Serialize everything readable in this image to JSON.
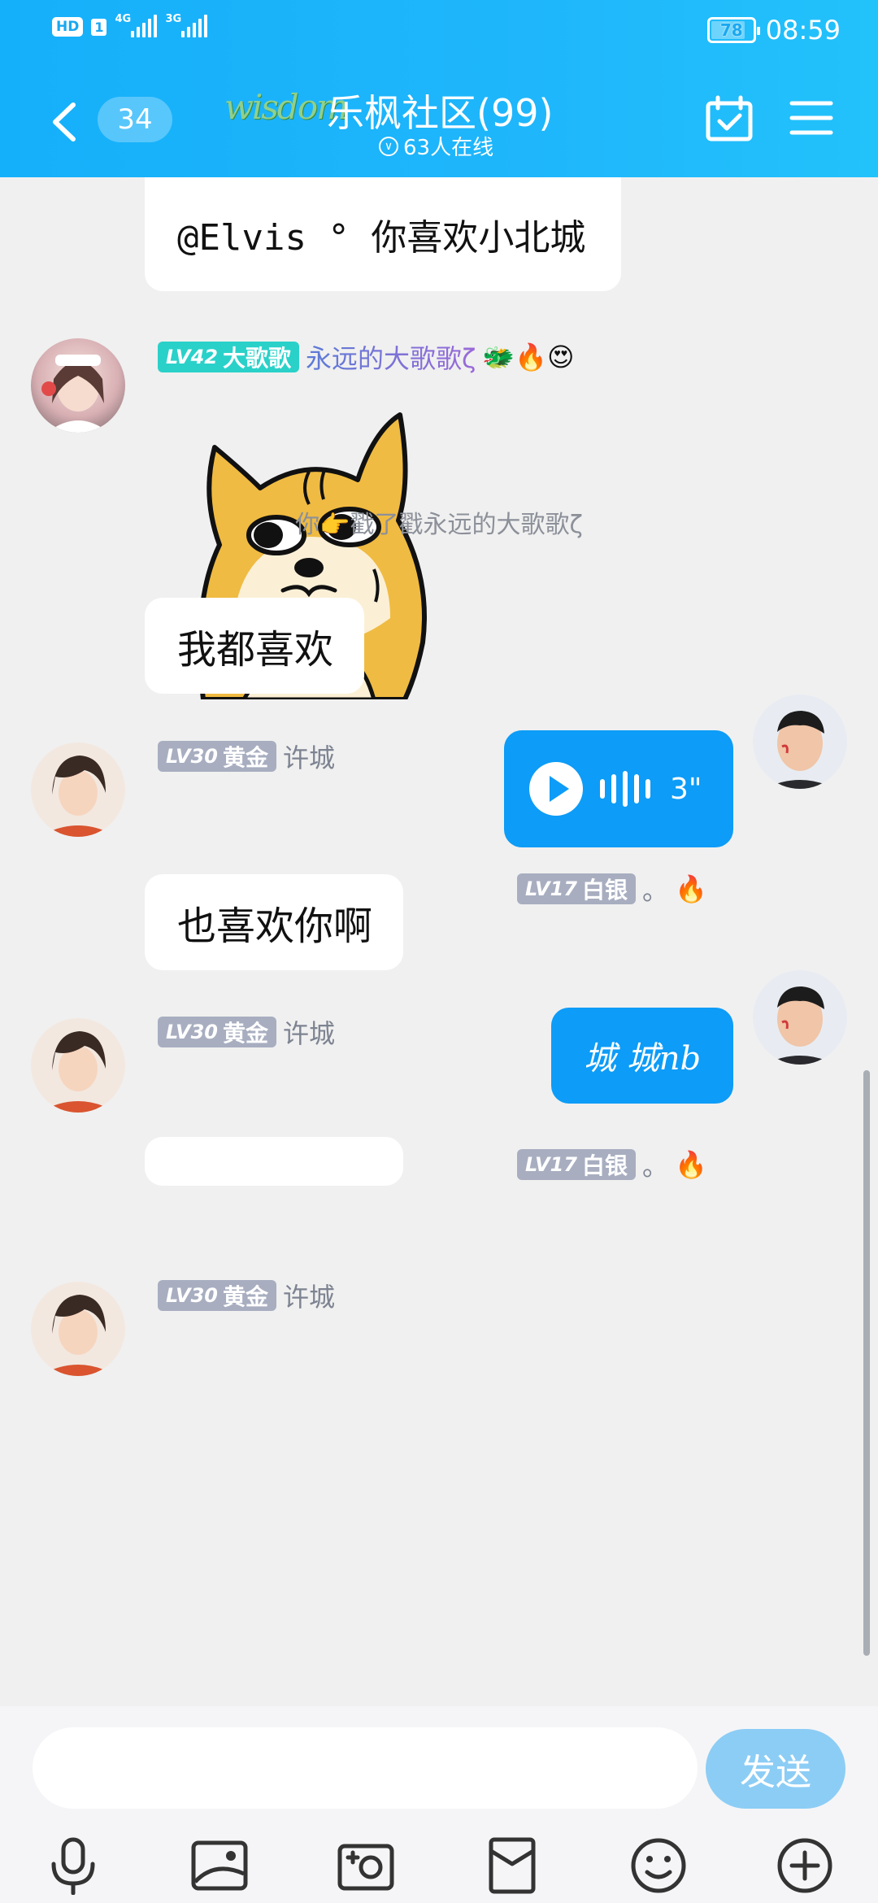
{
  "status_bar": {
    "hd_label": "HD",
    "sim_label": "1",
    "net1": "4G",
    "net2": "3G",
    "battery": "78",
    "time": "08:59"
  },
  "nav": {
    "unread_count": "34",
    "logo_text": "wisdom",
    "group_title": "乐枫社区(99)",
    "online_text": "63人在线"
  },
  "messages": [
    {
      "type": "partial",
      "text": "@Elvis ° 你喜欢小北城"
    },
    {
      "type": "sticker",
      "level_num": "LV42",
      "title": "大歌歌",
      "nickname": "永远的大歌歌ζ",
      "emoji": "🐲🔥😍"
    },
    {
      "type": "system",
      "text": "你👉戳了戳永远的大歌歌ζ"
    },
    {
      "type": "text",
      "level_num": "LV30",
      "title": "黄金",
      "nickname": "许城",
      "text": "我都喜欢"
    },
    {
      "type": "voice",
      "level_num": "LV17",
      "title": "白银",
      "nickname": "。",
      "emoji": "🔥",
      "duration": "3\""
    },
    {
      "type": "text",
      "level_num": "LV30",
      "title": "黄金",
      "nickname": "许城",
      "text": "也喜欢你啊"
    },
    {
      "type": "text_me",
      "level_num": "LV17",
      "title": "白银",
      "nickname": "。",
      "emoji": "🔥",
      "text": "城 城nb"
    },
    {
      "type": "partial_bottom",
      "level_num": "LV30",
      "title": "黄金",
      "nickname": "许城"
    }
  ],
  "input": {
    "placeholder": "",
    "send_label": "发送"
  },
  "toolbar_icons": [
    "microphone-icon",
    "image-icon",
    "camera-icon",
    "red-packet-icon",
    "emoji-icon",
    "plus-icon"
  ],
  "colors": {
    "header": "#15b0fa",
    "my_bubble": "#0d9cf7",
    "send_button": "#8ccdf5",
    "background": "#f0f0f0"
  }
}
